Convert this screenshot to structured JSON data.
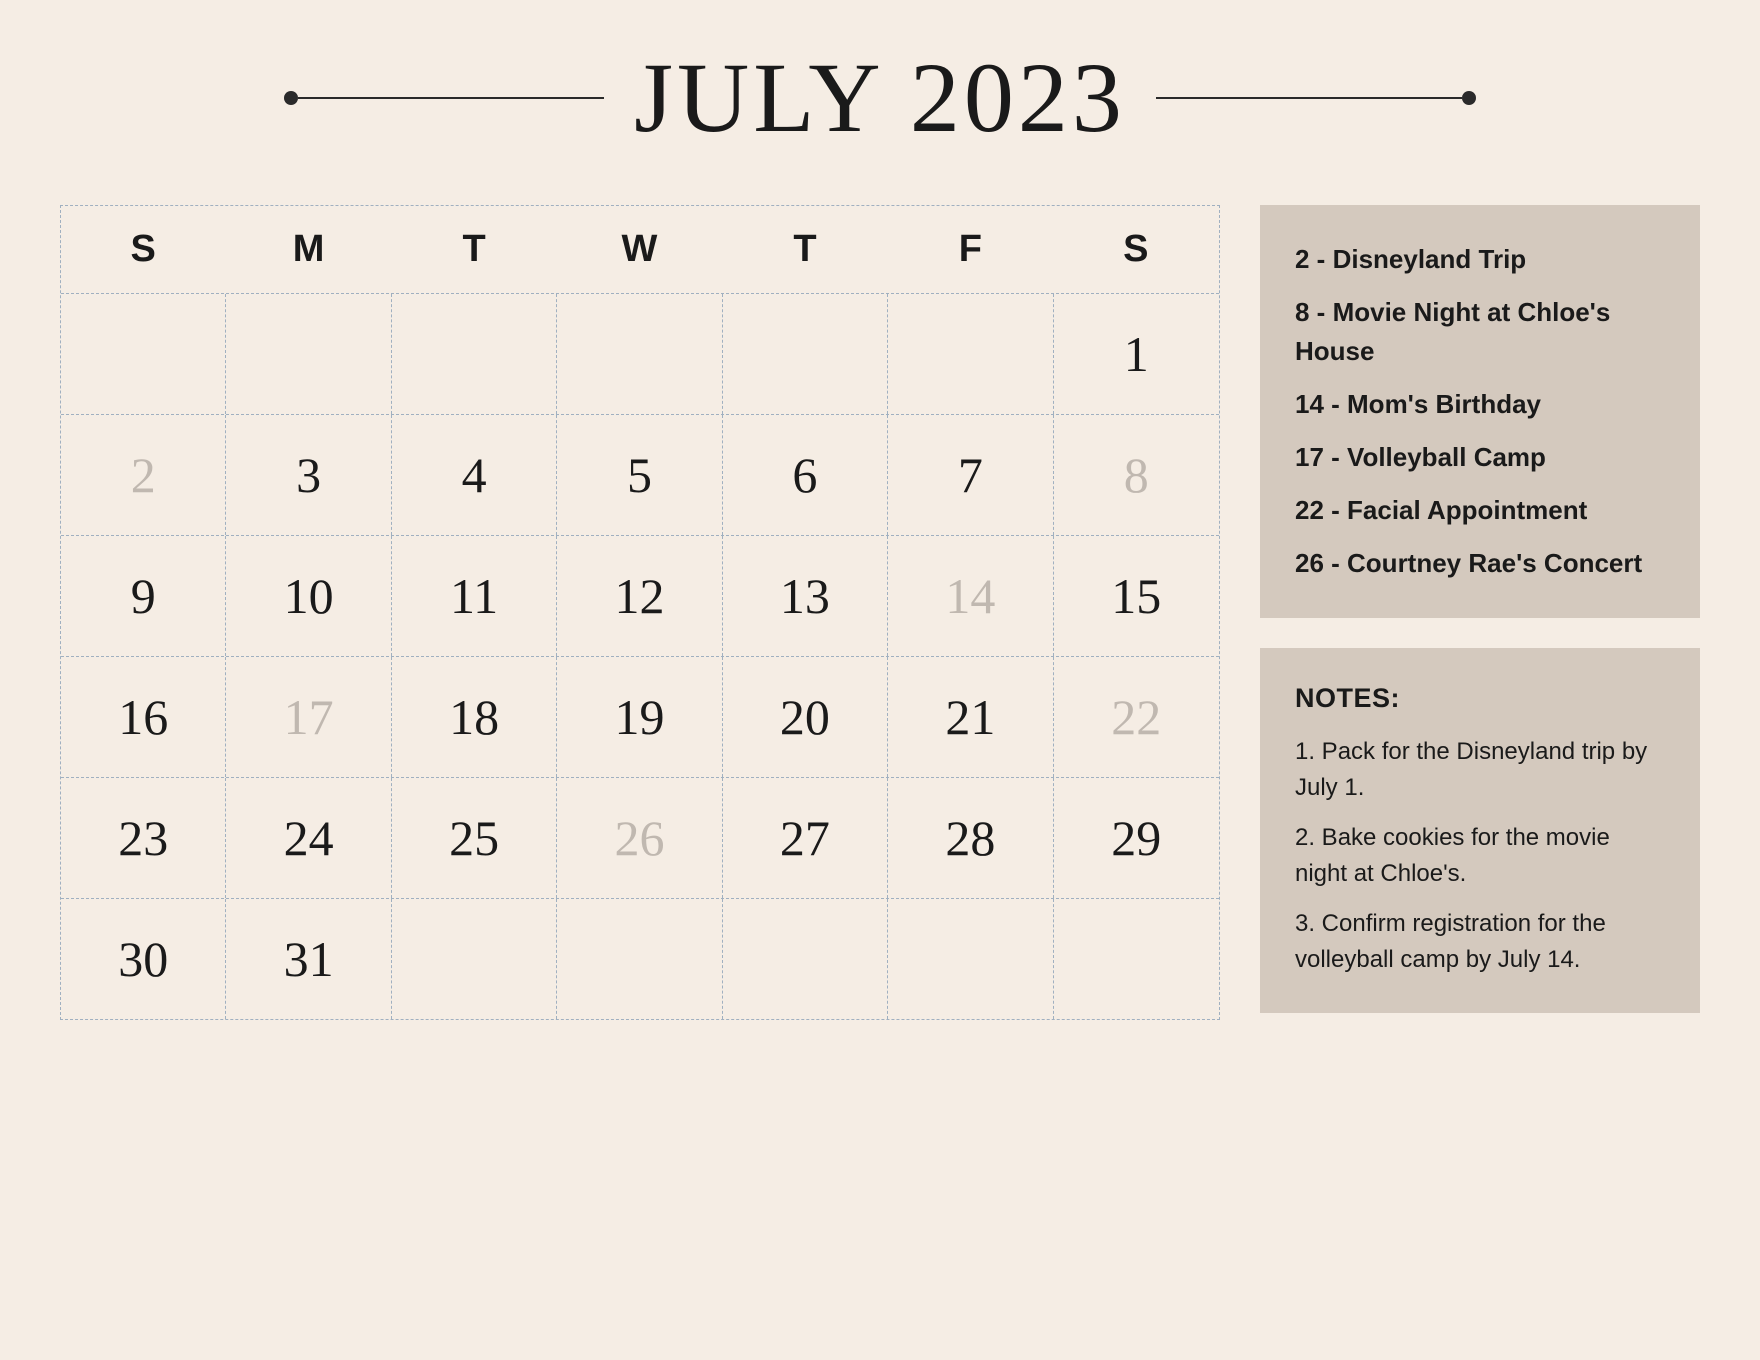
{
  "header": {
    "title": "JULY 2023"
  },
  "calendar": {
    "day_names": [
      "S",
      "M",
      "T",
      "W",
      "T",
      "F",
      "S"
    ],
    "rows": [
      [
        {
          "day": "",
          "faded": false
        },
        {
          "day": "",
          "faded": false
        },
        {
          "day": "",
          "faded": false
        },
        {
          "day": "",
          "faded": false
        },
        {
          "day": "",
          "faded": false
        },
        {
          "day": "",
          "faded": false
        },
        {
          "day": "1",
          "faded": false
        }
      ],
      [
        {
          "day": "2",
          "faded": true
        },
        {
          "day": "3",
          "faded": false
        },
        {
          "day": "4",
          "faded": false
        },
        {
          "day": "5",
          "faded": false
        },
        {
          "day": "6",
          "faded": false
        },
        {
          "day": "7",
          "faded": false
        },
        {
          "day": "8",
          "faded": true
        }
      ],
      [
        {
          "day": "9",
          "faded": false
        },
        {
          "day": "10",
          "faded": false
        },
        {
          "day": "11",
          "faded": false
        },
        {
          "day": "12",
          "faded": false
        },
        {
          "day": "13",
          "faded": false
        },
        {
          "day": "14",
          "faded": true
        },
        {
          "day": "15",
          "faded": false
        }
      ],
      [
        {
          "day": "16",
          "faded": false
        },
        {
          "day": "17",
          "faded": true
        },
        {
          "day": "18",
          "faded": false
        },
        {
          "day": "19",
          "faded": false
        },
        {
          "day": "20",
          "faded": false
        },
        {
          "day": "21",
          "faded": false
        },
        {
          "day": "22",
          "faded": true
        }
      ],
      [
        {
          "day": "23",
          "faded": false
        },
        {
          "day": "24",
          "faded": false
        },
        {
          "day": "25",
          "faded": false
        },
        {
          "day": "26",
          "faded": true
        },
        {
          "day": "27",
          "faded": false
        },
        {
          "day": "28",
          "faded": false
        },
        {
          "day": "29",
          "faded": false
        }
      ],
      [
        {
          "day": "30",
          "faded": false
        },
        {
          "day": "31",
          "faded": false
        },
        {
          "day": "",
          "faded": false
        },
        {
          "day": "",
          "faded": false
        },
        {
          "day": "",
          "faded": false
        },
        {
          "day": "",
          "faded": false
        },
        {
          "day": "",
          "faded": false
        }
      ]
    ]
  },
  "events": {
    "items": [
      "2 - Disneyland Trip",
      "8 - Movie Night at Chloe's House",
      "14 - Mom's Birthday",
      "17 - Volleyball Camp",
      "22 - Facial Appointment",
      "26 - Courtney Rae's Concert"
    ]
  },
  "notes": {
    "title": "NOTES:",
    "items": [
      "1. Pack for the Disneyland trip by July 1.",
      "2. Bake cookies for the movie night at Chloe's.",
      "3. Confirm registration for the volleyball camp by July 14."
    ]
  }
}
